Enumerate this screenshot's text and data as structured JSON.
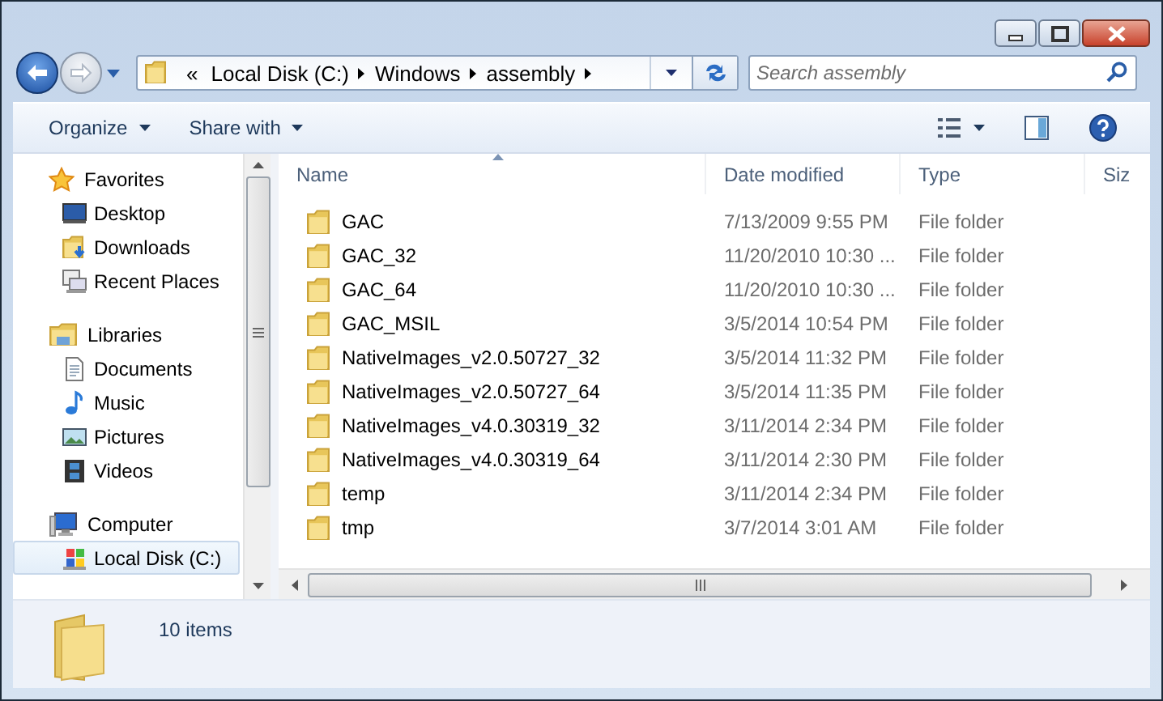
{
  "address": {
    "overflow": "«",
    "crumbs": [
      "Local Disk (C:)",
      "Windows",
      "assembly"
    ]
  },
  "search": {
    "placeholder": "Search assembly"
  },
  "toolbar": {
    "buttons": [
      "Organize",
      "Share with"
    ]
  },
  "sidebar": {
    "groups": [
      {
        "label": "Favorites",
        "kind": "favorites",
        "selected": false,
        "children": [
          {
            "label": "Desktop",
            "kind": "desktop",
            "selected": false
          },
          {
            "label": "Downloads",
            "kind": "downloads",
            "selected": false
          },
          {
            "label": "Recent Places",
            "kind": "recent",
            "selected": false
          }
        ]
      },
      {
        "label": "Libraries",
        "kind": "libraries",
        "selected": false,
        "children": [
          {
            "label": "Documents",
            "kind": "documents",
            "selected": false
          },
          {
            "label": "Music",
            "kind": "music",
            "selected": false
          },
          {
            "label": "Pictures",
            "kind": "pictures",
            "selected": false
          },
          {
            "label": "Videos",
            "kind": "videos",
            "selected": false
          }
        ]
      },
      {
        "label": "Computer",
        "kind": "computer",
        "selected": false,
        "children": [
          {
            "label": "Local Disk (C:)",
            "kind": "disk",
            "selected": true
          }
        ]
      }
    ]
  },
  "table": {
    "columns": [
      {
        "label": "Name",
        "sorted": true
      },
      {
        "label": "Date modified",
        "sorted": false
      },
      {
        "label": "Type",
        "sorted": false
      },
      {
        "label": "Siz",
        "sorted": false
      }
    ],
    "rows": [
      {
        "name": "GAC",
        "date": "7/13/2009 9:55 PM",
        "type": "File folder"
      },
      {
        "name": "GAC_32",
        "date": "11/20/2010 10:30 ...",
        "type": "File folder"
      },
      {
        "name": "GAC_64",
        "date": "11/20/2010 10:30 ...",
        "type": "File folder"
      },
      {
        "name": "GAC_MSIL",
        "date": "3/5/2014 10:54 PM",
        "type": "File folder"
      },
      {
        "name": "NativeImages_v2.0.50727_32",
        "date": "3/5/2014 11:32 PM",
        "type": "File folder"
      },
      {
        "name": "NativeImages_v2.0.50727_64",
        "date": "3/5/2014 11:35 PM",
        "type": "File folder"
      },
      {
        "name": "NativeImages_v4.0.30319_32",
        "date": "3/11/2014 2:34 PM",
        "type": "File folder"
      },
      {
        "name": "NativeImages_v4.0.30319_64",
        "date": "3/11/2014 2:30 PM",
        "type": "File folder"
      },
      {
        "name": "temp",
        "date": "3/11/2014 2:34 PM",
        "type": "File folder"
      },
      {
        "name": "tmp",
        "date": "3/7/2014 3:01 AM",
        "type": "File folder"
      }
    ]
  },
  "status_bar": {
    "count": "10 items"
  }
}
